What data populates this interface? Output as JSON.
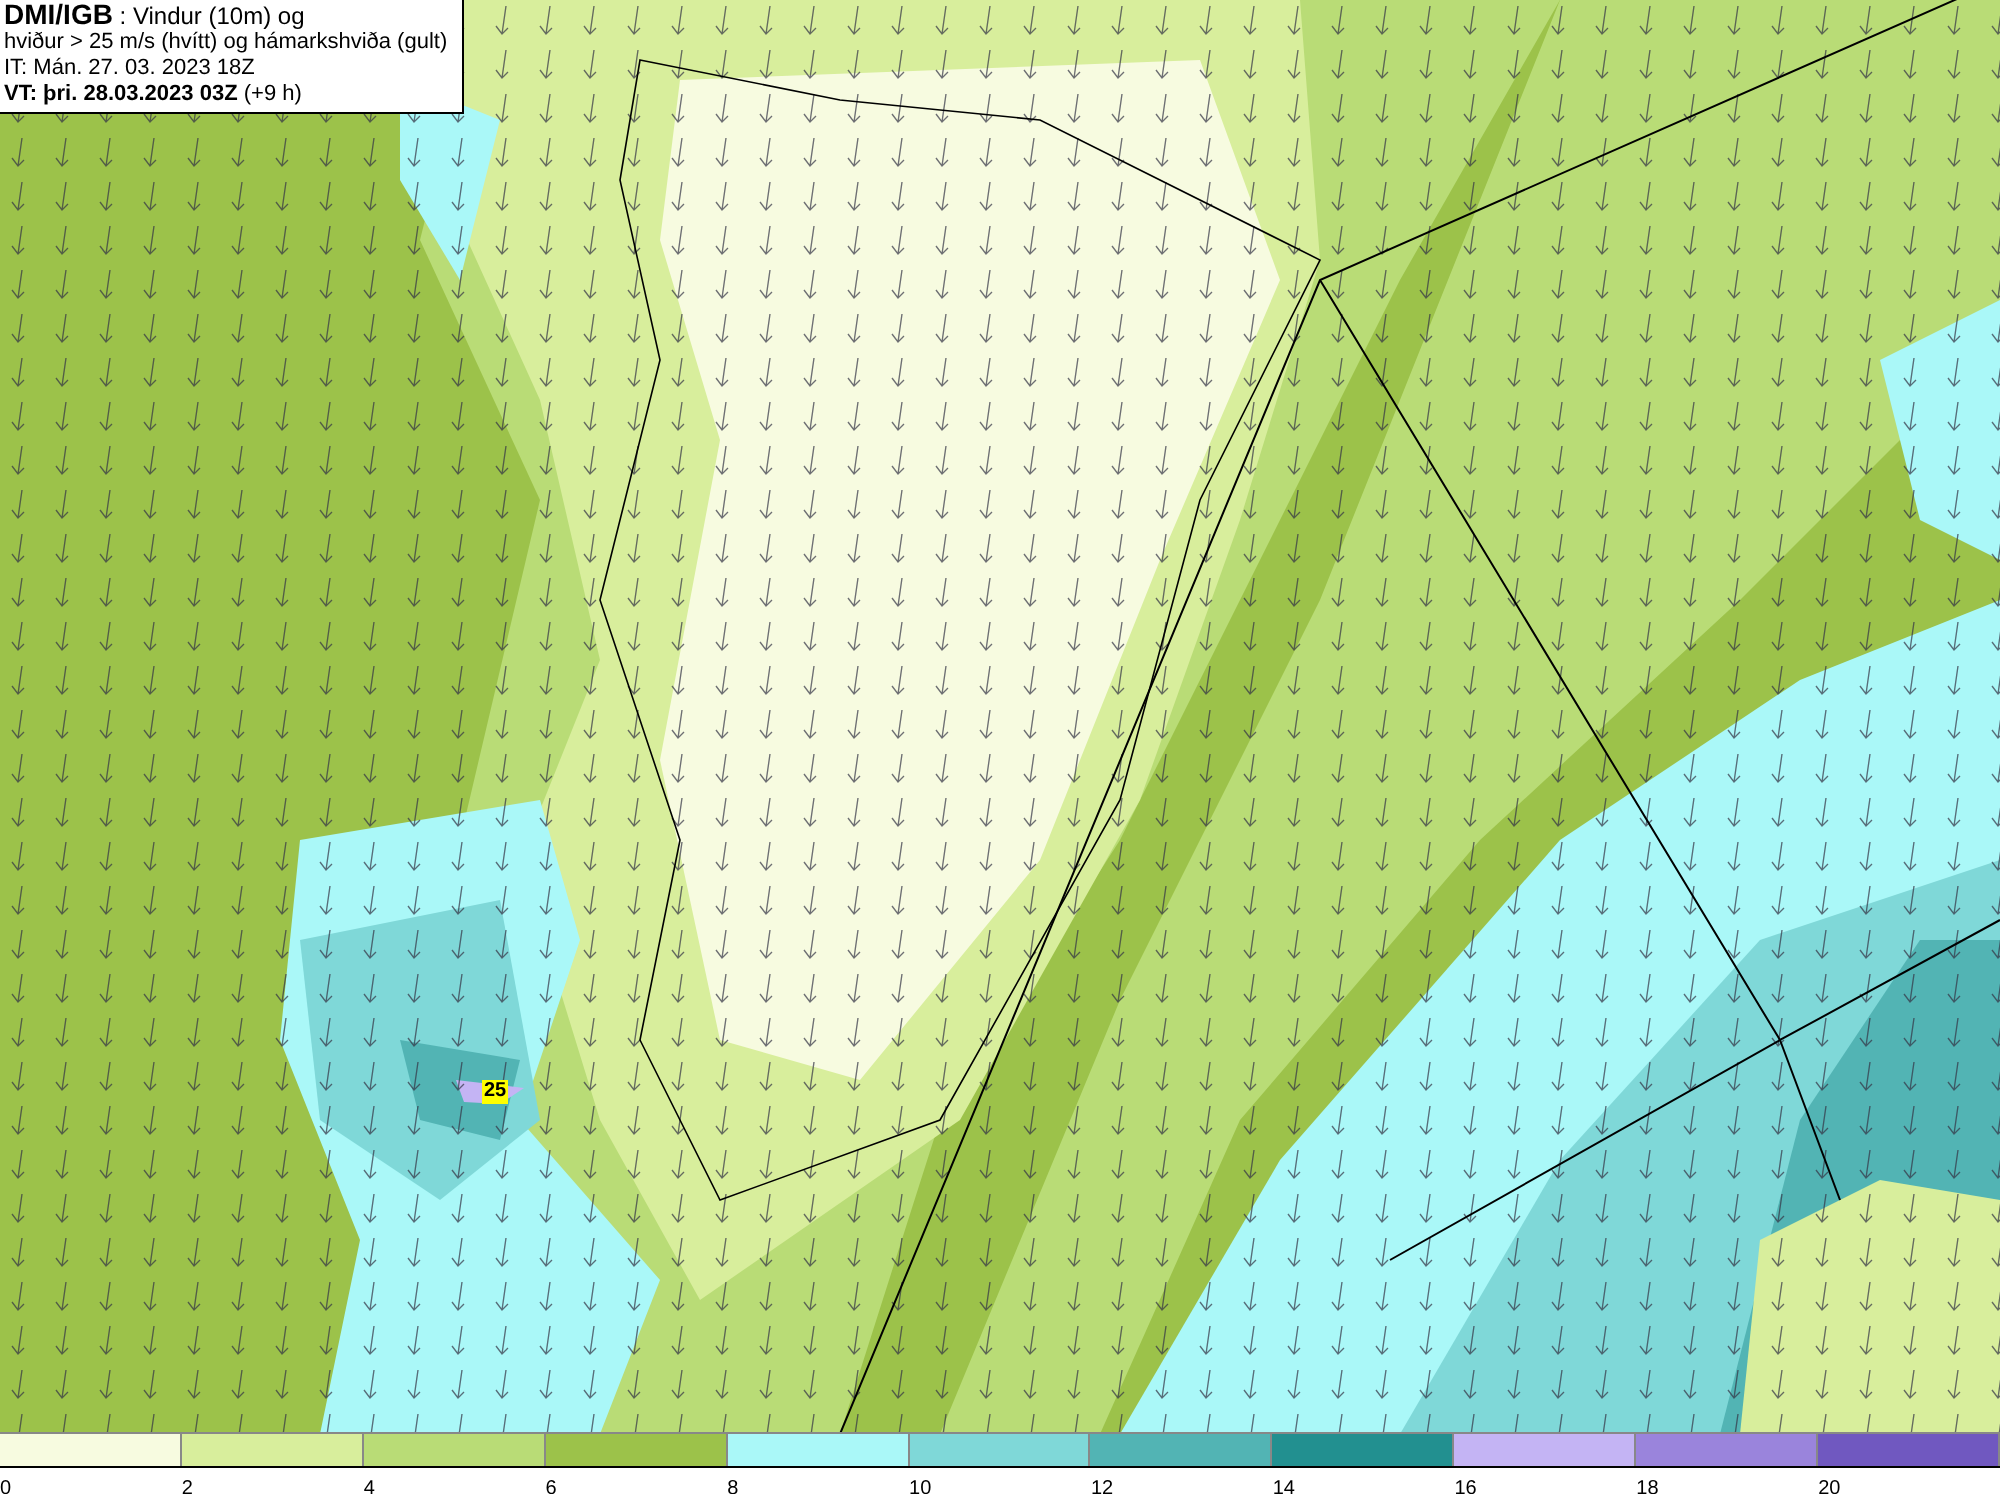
{
  "header": {
    "lines": [
      "**DMI/IGB** : Vindur (10m) og",
      "hviður > 25 m/s (hvítt) og hámarkshviða (gult)",
      "IT: Mán. 27. 03. 2023 18Z",
      "**VT: þri. 28.03.2023 03Z** (+9 h)"
    ]
  },
  "map": {
    "gust_label": "25"
  },
  "legend": {
    "segments": [
      {
        "color": "#f7fbe0"
      },
      {
        "color": "#d8ee9c"
      },
      {
        "color": "#b9dc76"
      },
      {
        "color": "#9cc24a"
      },
      {
        "color": "#aaf8f8"
      },
      {
        "color": "#7fd8d8"
      },
      {
        "color": "#52b4b4"
      },
      {
        "color": "#229090"
      },
      {
        "color": "#c4b4f4"
      },
      {
        "color": "#9a84dc"
      },
      {
        "color": "#7058c0"
      }
    ],
    "labels": [
      "0",
      "2",
      "4",
      "6",
      "8",
      "10",
      "12",
      "14",
      "16",
      "18",
      "20"
    ]
  }
}
